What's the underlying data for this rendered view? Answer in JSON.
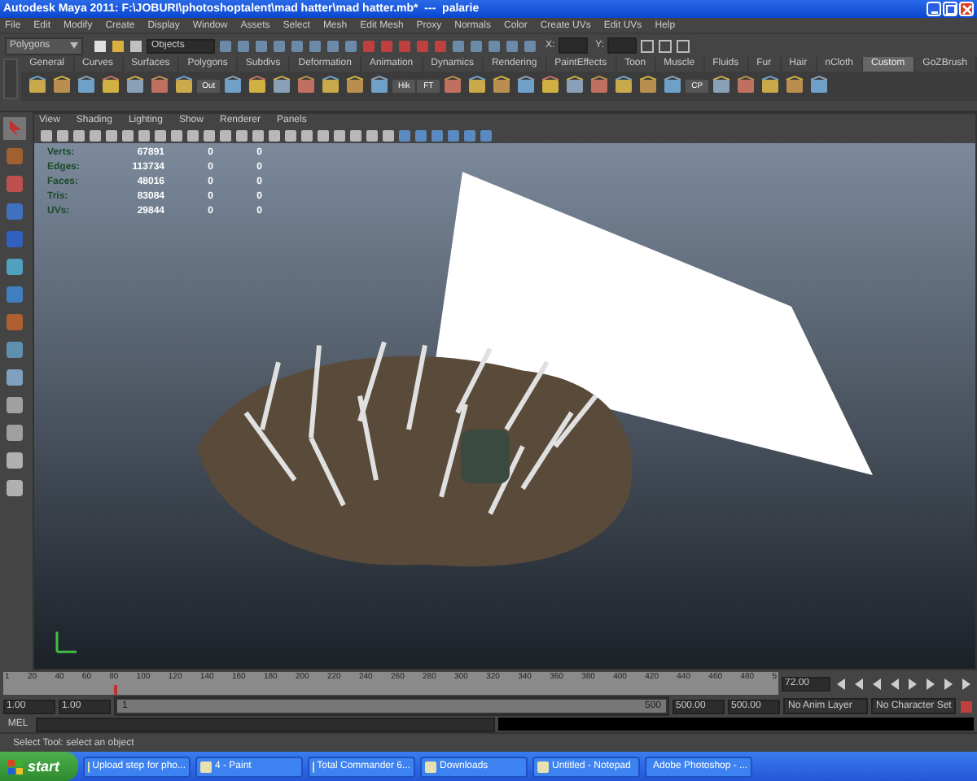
{
  "window": {
    "title": "Autodesk Maya 2011: F:\\JOBURI\\photoshoptalent\\mad hatter\\mad hatter.mb*  ---  palarie"
  },
  "menu": [
    "File",
    "Edit",
    "Modify",
    "Create",
    "Display",
    "Window",
    "Assets",
    "Select",
    "Mesh",
    "Edit Mesh",
    "Proxy",
    "Normals",
    "Color",
    "Create UVs",
    "Edit UVs",
    "Help"
  ],
  "status_line": {
    "menu_set": "Polygons",
    "selection_field": "Objects",
    "x_label": "X:",
    "y_label": "Y:"
  },
  "shelf": {
    "tabs": [
      {
        "label": "General",
        "selected": false
      },
      {
        "label": "Curves",
        "selected": false
      },
      {
        "label": "Surfaces",
        "selected": false
      },
      {
        "label": "Polygons",
        "selected": false
      },
      {
        "label": "Subdivs",
        "selected": false
      },
      {
        "label": "Deformation",
        "selected": false
      },
      {
        "label": "Animation",
        "selected": false
      },
      {
        "label": "Dynamics",
        "selected": false
      },
      {
        "label": "Rendering",
        "selected": false
      },
      {
        "label": "PaintEffects",
        "selected": false
      },
      {
        "label": "Toon",
        "selected": false
      },
      {
        "label": "Muscle",
        "selected": false
      },
      {
        "label": "Fluids",
        "selected": false
      },
      {
        "label": "Fur",
        "selected": false
      },
      {
        "label": "Hair",
        "selected": false
      },
      {
        "label": "nCloth",
        "selected": false
      },
      {
        "label": "Custom",
        "selected": true
      },
      {
        "label": "GoZBrush",
        "selected": false
      }
    ],
    "icons": [
      {
        "kind": "tool"
      },
      {
        "kind": "tool"
      },
      {
        "kind": "tool"
      },
      {
        "kind": "tool"
      },
      {
        "kind": "tool"
      },
      {
        "kind": "tool"
      },
      {
        "kind": "tool"
      },
      {
        "kind": "labeled",
        "label": "Out"
      },
      {
        "kind": "tool"
      },
      {
        "kind": "tool"
      },
      {
        "kind": "tool"
      },
      {
        "kind": "tool"
      },
      {
        "kind": "tool"
      },
      {
        "kind": "tool"
      },
      {
        "kind": "tool"
      },
      {
        "kind": "labeled",
        "label": "Hik"
      },
      {
        "kind": "labeled",
        "label": "FT"
      },
      {
        "kind": "tool"
      },
      {
        "kind": "tool"
      },
      {
        "kind": "tool"
      },
      {
        "kind": "tool"
      },
      {
        "kind": "tool"
      },
      {
        "kind": "tool"
      },
      {
        "kind": "tool"
      },
      {
        "kind": "tool"
      },
      {
        "kind": "tool"
      },
      {
        "kind": "tool"
      },
      {
        "kind": "labeled",
        "label": "CP"
      },
      {
        "kind": "tool"
      },
      {
        "kind": "tool"
      },
      {
        "kind": "tool"
      },
      {
        "kind": "tool"
      },
      {
        "kind": "tool"
      }
    ]
  },
  "viewport": {
    "menu": [
      "View",
      "Shading",
      "Lighting",
      "Show",
      "Renderer",
      "Panels"
    ],
    "stats": [
      {
        "label": "Verts:",
        "values": [
          "67891",
          "0",
          "0"
        ]
      },
      {
        "label": "Edges:",
        "values": [
          "113734",
          "0",
          "0"
        ]
      },
      {
        "label": "Faces:",
        "values": [
          "48016",
          "0",
          "0"
        ]
      },
      {
        "label": "Tris:",
        "values": [
          "83084",
          "0",
          "0"
        ]
      },
      {
        "label": "UVs:",
        "values": [
          "29844",
          "0",
          "0"
        ]
      }
    ]
  },
  "timeline": {
    "ticks": [
      "1",
      "20",
      "40",
      "60",
      "80",
      "100",
      "120",
      "140",
      "160",
      "180",
      "200",
      "220",
      "240",
      "260",
      "280",
      "300",
      "320",
      "340",
      "360",
      "380",
      "400",
      "420",
      "440",
      "460",
      "480",
      "5"
    ],
    "current_time": "72.00",
    "level": 0.142
  },
  "range": {
    "start_time": "1.00",
    "playback_start": "1.00",
    "slider_start": "1",
    "slider_end": "500",
    "level": 1,
    "playback_end": "500.00",
    "end_time": "500.00",
    "anim_layer": "No Anim Layer",
    "character_set": "No Character Set"
  },
  "command_line": {
    "label": "MEL"
  },
  "help_line": "Select Tool: select an object",
  "taskbar": {
    "start": "start",
    "items": [
      "Upload step for pho...",
      "4 - Paint",
      "Total Commander 6...",
      "Downloads",
      "Untitled - Notepad",
      "Adobe Photoshop - ..."
    ]
  }
}
